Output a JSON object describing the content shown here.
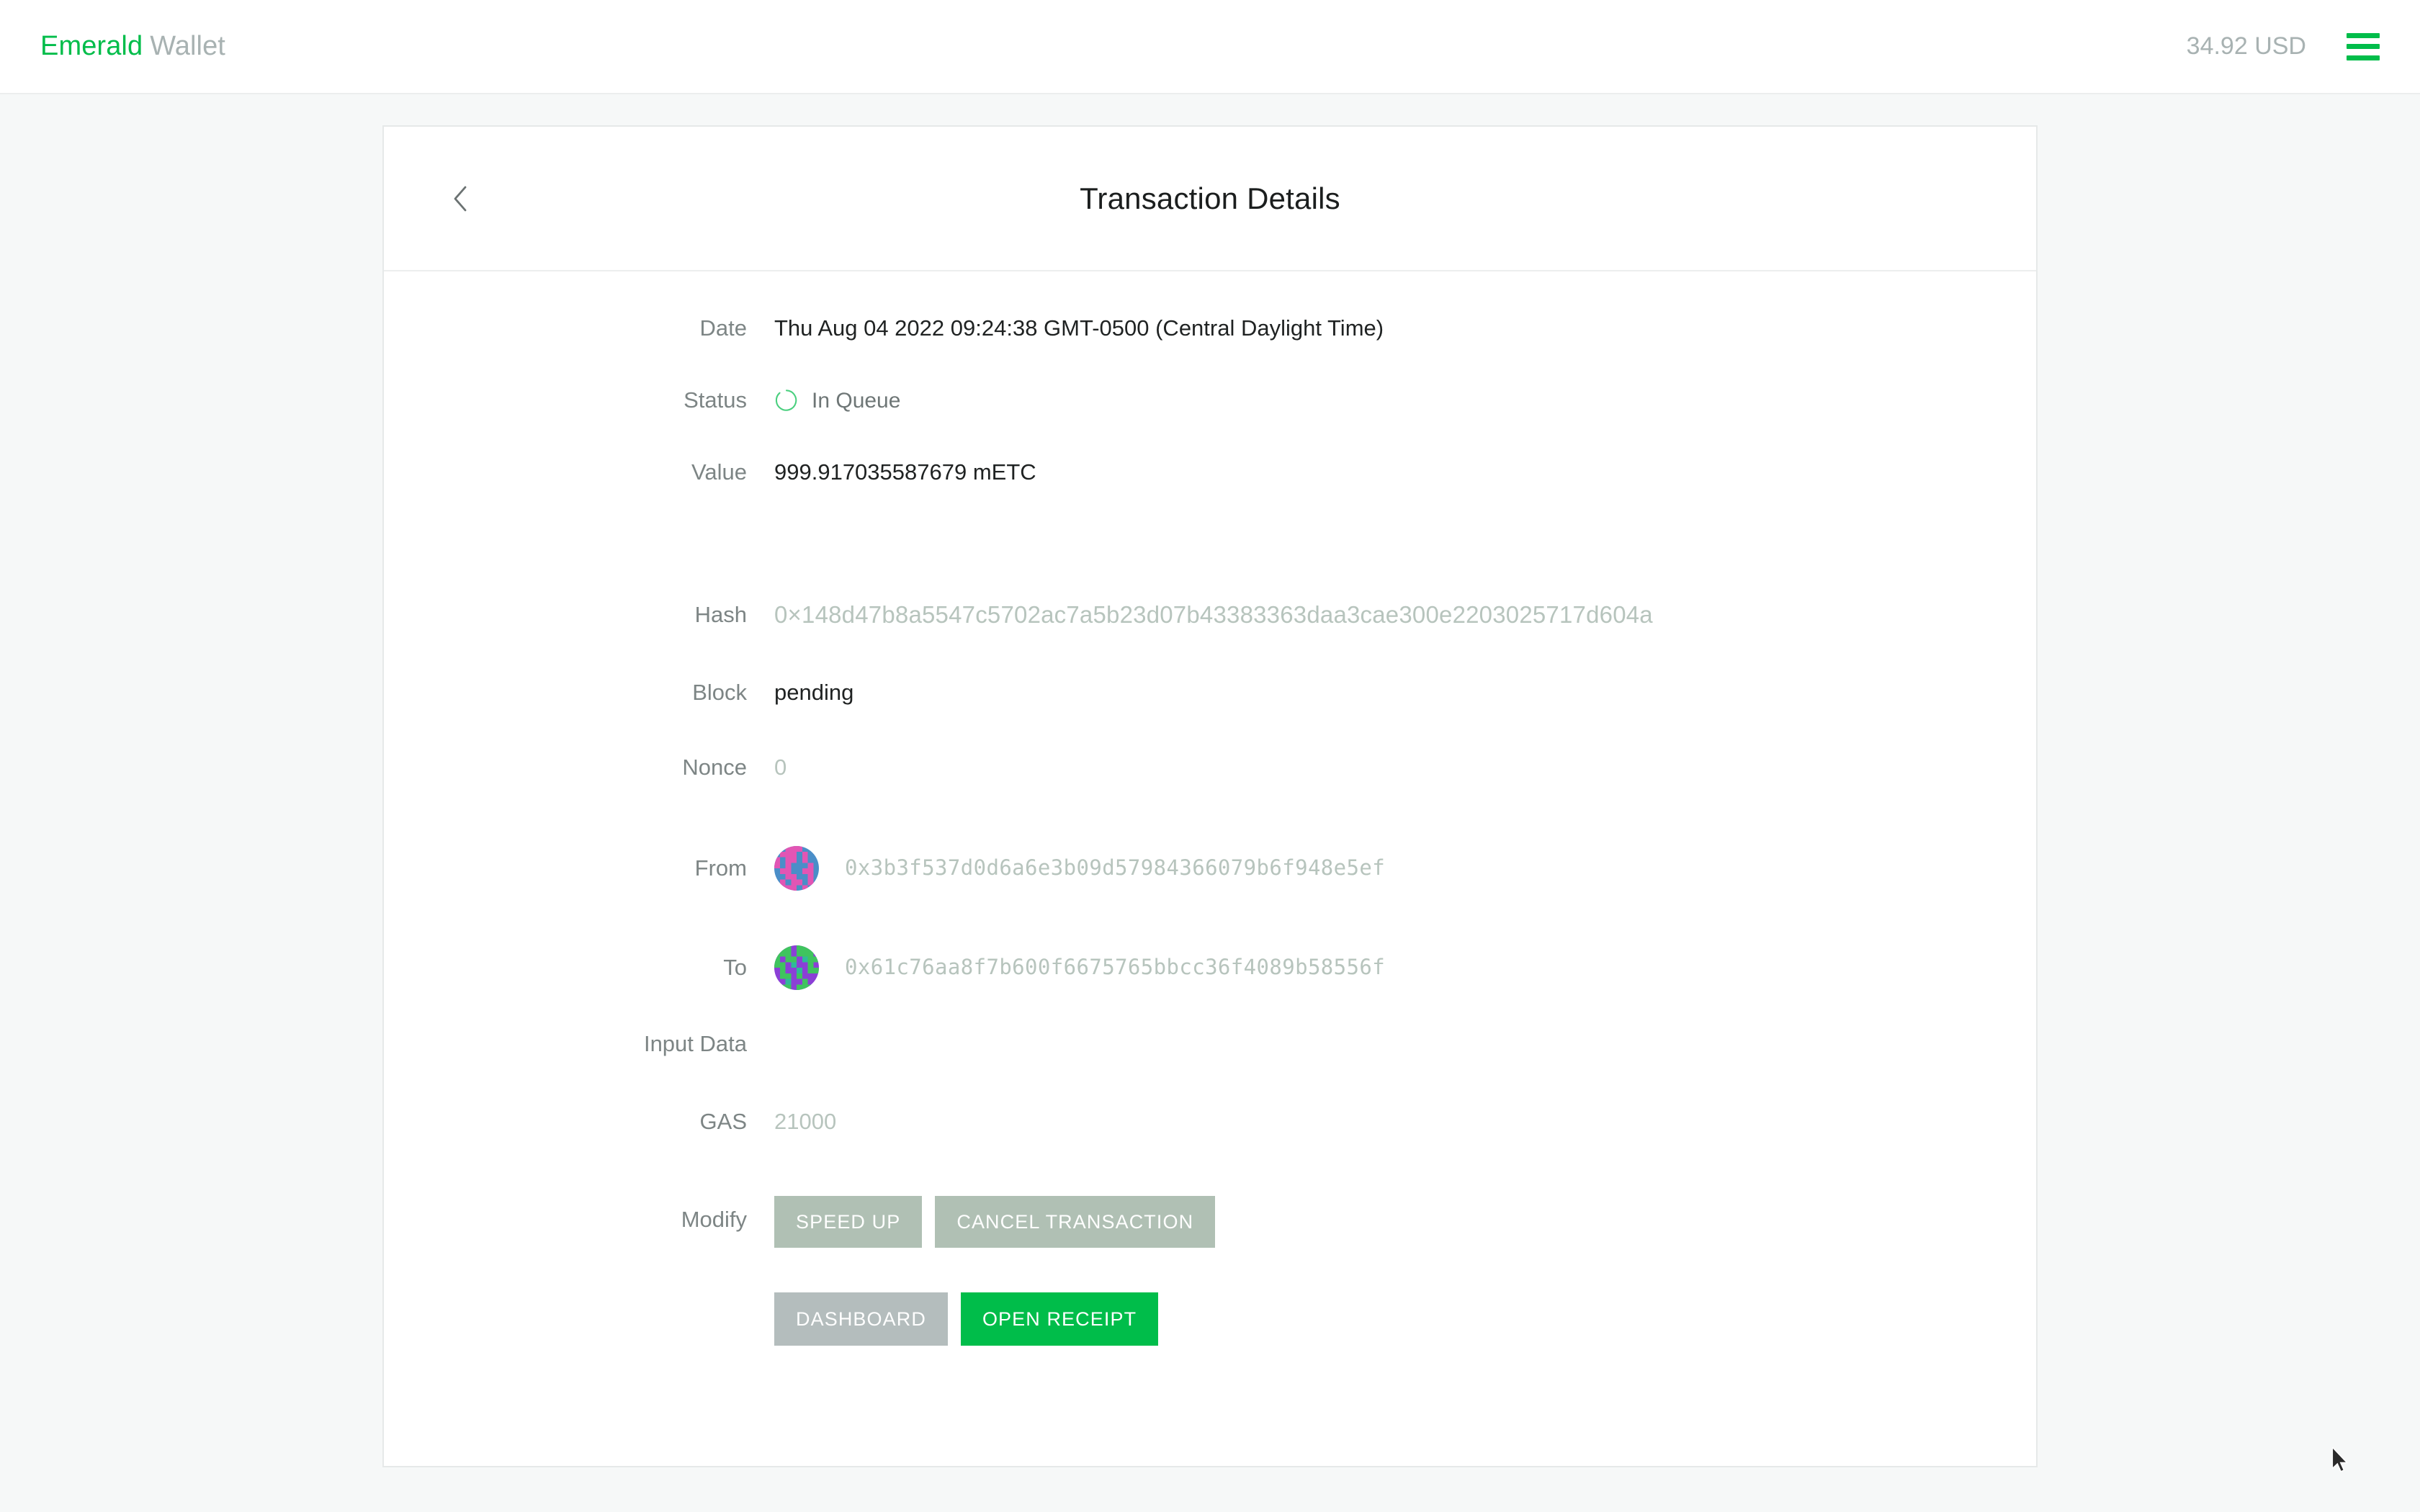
{
  "topbar": {
    "brand_primary": "Emerald",
    "brand_secondary": "Wallet",
    "fiat_total": "34.92 USD",
    "menu_icon": "hamburger-menu-icon"
  },
  "card": {
    "title": "Transaction Details",
    "back_icon": "chevron-left-icon"
  },
  "details": {
    "date_label": "Date",
    "date_value": "Thu Aug 04 2022 09:24:38 GMT-0500 (Central Daylight Time)",
    "status_label": "Status",
    "status_value": "In Queue",
    "status_icon": "spinner-icon",
    "value_label": "Value",
    "value_value": "999.917035587679 mETC",
    "hash_label": "Hash",
    "hash_value": "0×148d47b8a5547c5702ac7a5b23d07b43383363daa3cae300e2203025717d604a",
    "block_label": "Block",
    "block_value": "pending",
    "nonce_label": "Nonce",
    "nonce_value": "0",
    "from_label": "From",
    "from_value": "0x3b3f537d0d6a6e3b09d57984366079b6f948e5ef",
    "from_identicon": "address-identicon",
    "to_label": "To",
    "to_value": "0x61c76aa8f7b600f6675765bbcc36f4089b58556f",
    "to_identicon": "address-identicon",
    "input_data_label": "Input Data",
    "input_data_value": "",
    "gas_label": "GAS",
    "gas_value": "21000",
    "modify_label": "Modify"
  },
  "buttons": {
    "speed_up": "SPEED UP",
    "cancel_transaction": "CANCEL TRANSACTION",
    "dashboard": "DASHBOARD",
    "open_receipt": "OPEN RECEIPT"
  },
  "colors": {
    "brand_green": "#00bd4a",
    "muted_text": "#b7c4bd",
    "label_text": "#7d8585",
    "sage_button": "#b0c0b4",
    "grey_button": "#b4bdbd",
    "page_background": "#f6f8f8"
  }
}
